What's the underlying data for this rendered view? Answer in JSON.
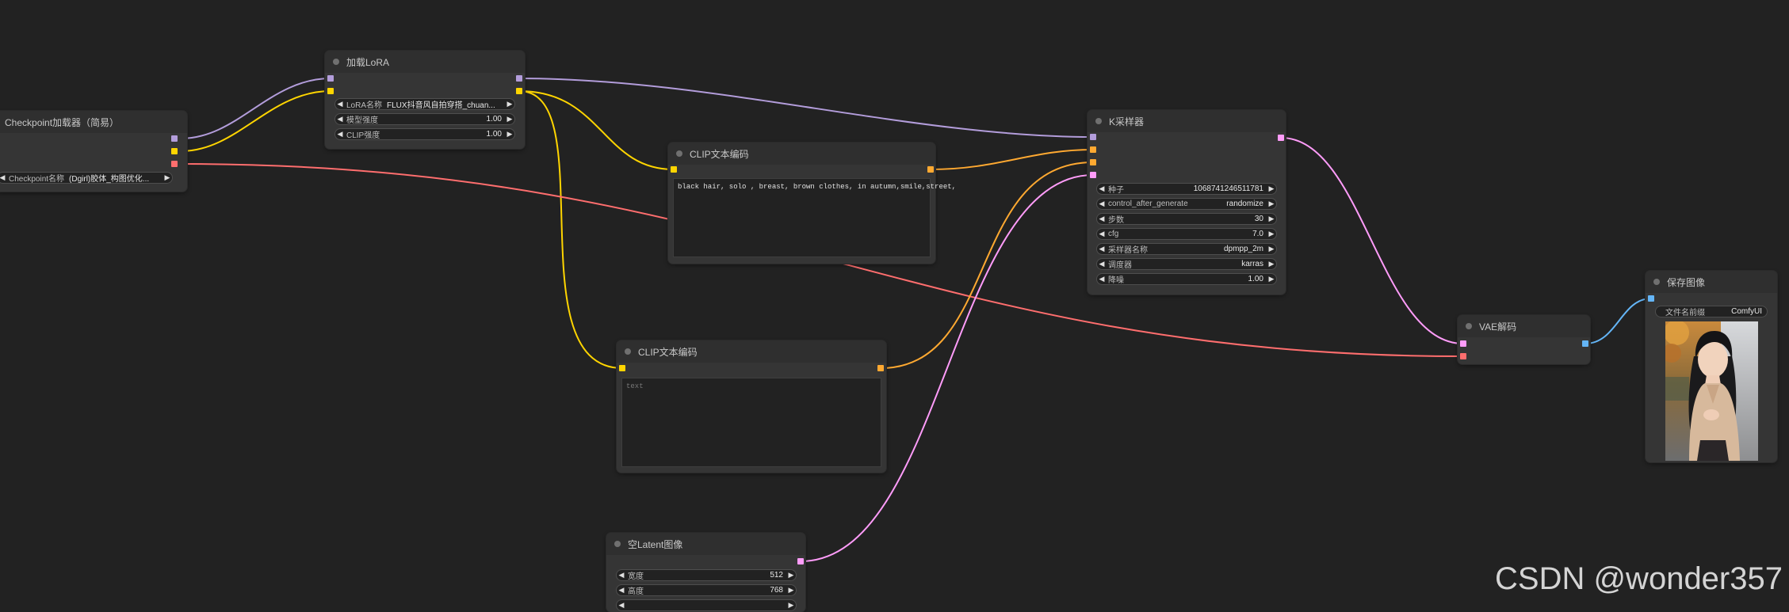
{
  "colors": {
    "canvas": "#222222",
    "node_body": "#353535",
    "node_header": "#2f2f2f",
    "clip": "#FFD500",
    "model": "#B39DDB",
    "vae": "#FF6E6E",
    "conditioning": "#FFA931",
    "latent": "#FF9CF9",
    "image": "#64B5F6"
  },
  "nodes": {
    "checkpoint": {
      "title": "Checkpoint加载器（简易）",
      "ckpt_label": "Checkpoint名称",
      "ckpt_value": "(Dgirl)胶体_构图优化..."
    },
    "lora": {
      "title": "加载LoRA",
      "lora_name_label": "LoRA名称",
      "lora_name_value": "FLUX抖音风自拍穿搭_chuan...",
      "model_strength_label": "模型强度",
      "model_strength_value": "1.00",
      "clip_strength_label": "CLIP强度",
      "clip_strength_value": "1.00"
    },
    "clip_pos": {
      "title": "CLIP文本编码",
      "text": "black hair, solo , breast, brown clothes, in autumn,smile,street,"
    },
    "clip_neg": {
      "title": "CLIP文本编码",
      "placeholder": "text"
    },
    "ksampler": {
      "title": "K采样器",
      "widgets": [
        {
          "label": "种子",
          "value": "1068741246511781"
        },
        {
          "label": "control_after_generate",
          "value": "randomize"
        },
        {
          "label": "步数",
          "value": "30"
        },
        {
          "label": "cfg",
          "value": "7.0"
        },
        {
          "label": "采样器名称",
          "value": "dpmpp_2m"
        },
        {
          "label": "调度器",
          "value": "karras"
        },
        {
          "label": "降噪",
          "value": "1.00"
        }
      ]
    },
    "vae_decode": {
      "title": "VAE解码"
    },
    "save_image": {
      "title": "保存图像",
      "prefix_label": "文件名前缀",
      "prefix_value": "ComfyUI"
    },
    "empty_latent": {
      "title": "空Latent图像",
      "width_label": "宽度",
      "width_value": "512",
      "height_label": "高度",
      "height_value": "768"
    }
  },
  "watermark": "CSDN @wonder357"
}
